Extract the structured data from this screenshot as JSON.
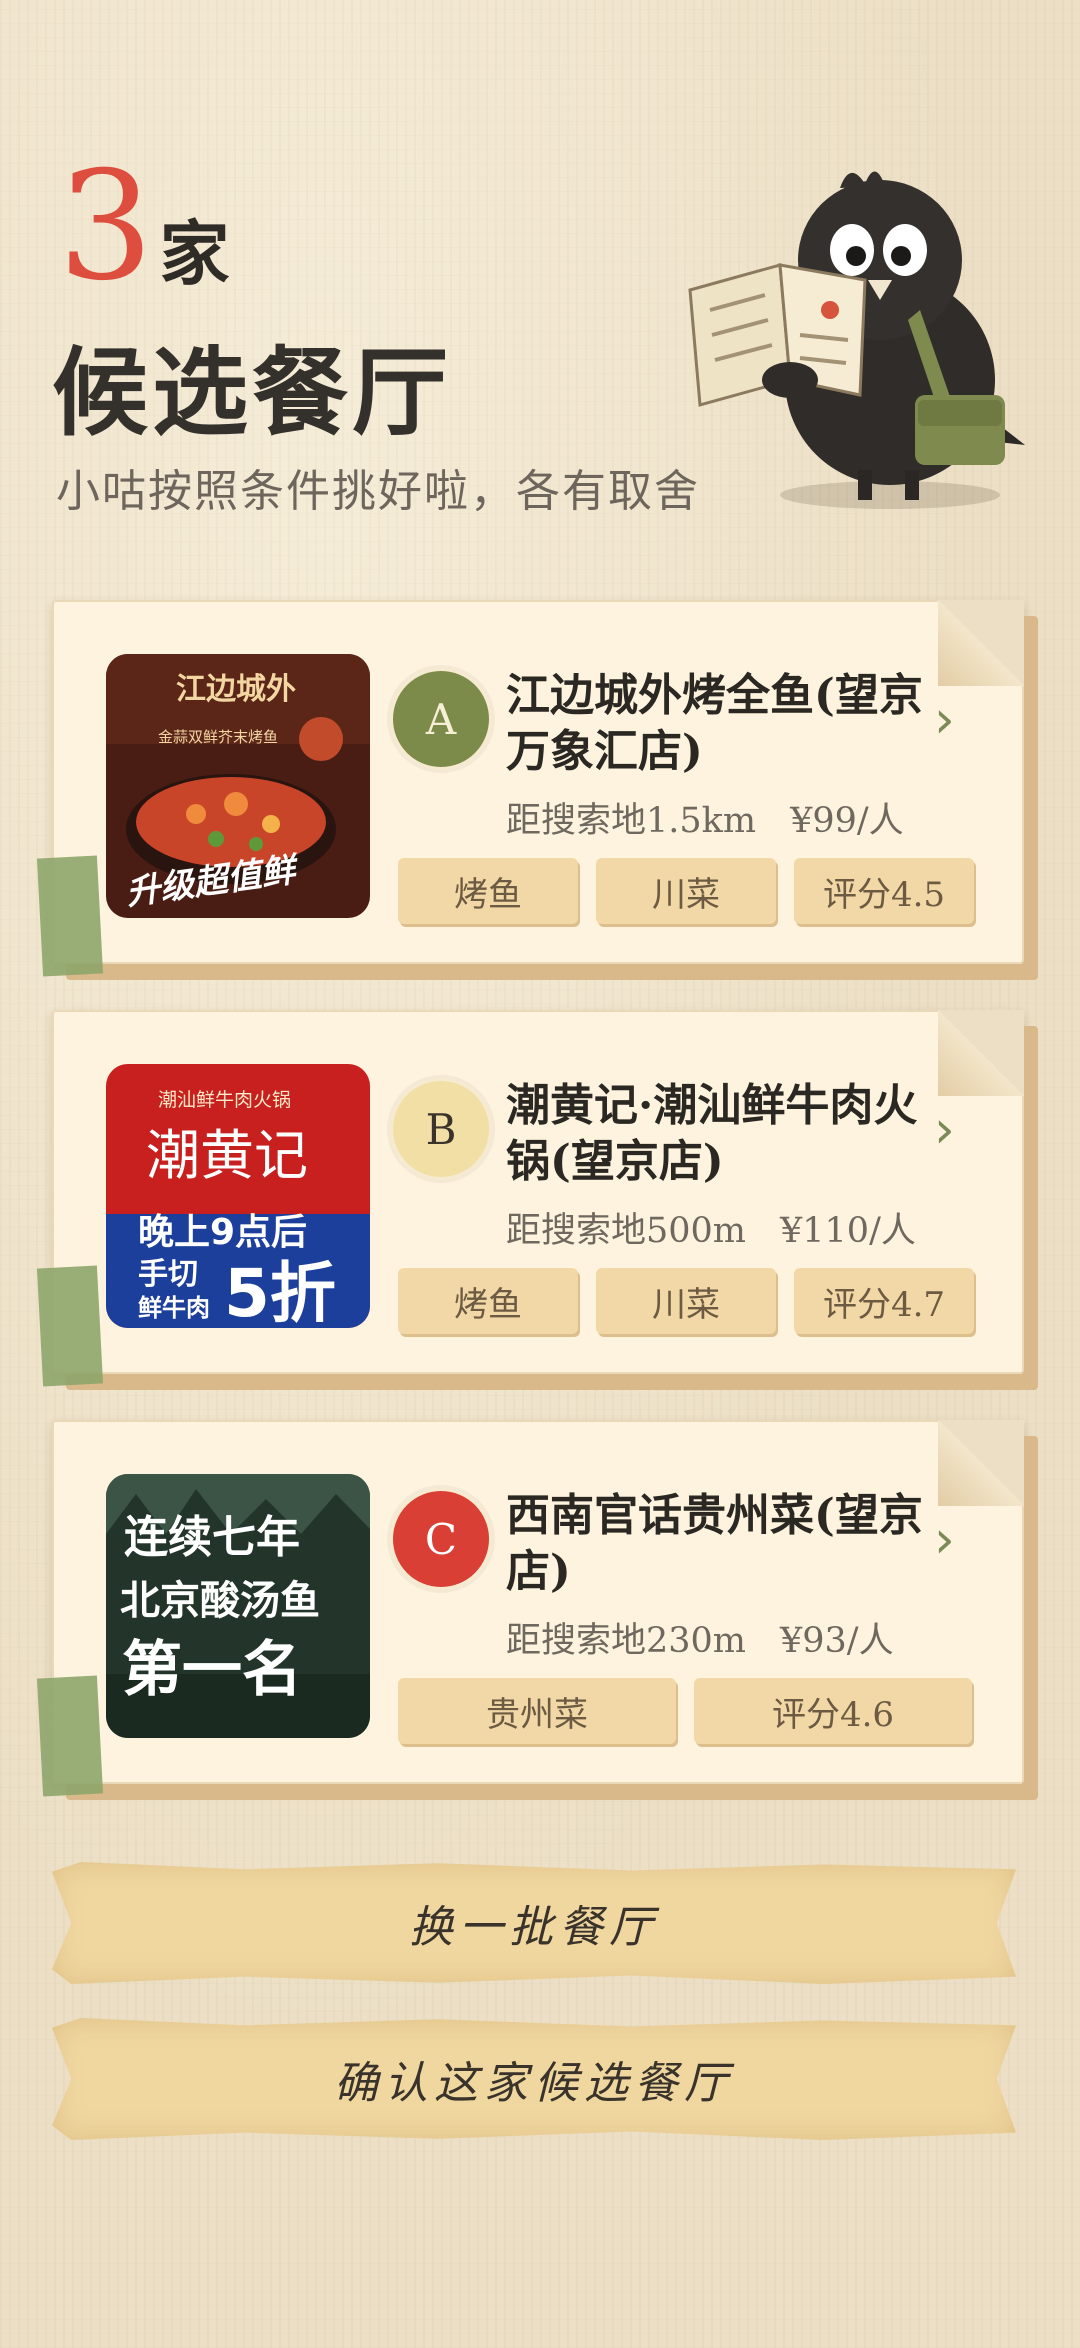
{
  "header": {
    "count_num": "3",
    "count_unit": "家",
    "title": "候选餐厅",
    "subtitle": "小咕按照条件挑好啦，各有取舍"
  },
  "restaurants": [
    {
      "badge": "A",
      "badge_color": "#7c8a4a",
      "badge_text_color": "#f7eed6",
      "name": "江边城外烤全鱼(望京万象汇店)",
      "distance": "距搜索地1.5km",
      "price": "¥99/人",
      "image_text": [
        "江边城外",
        "金蒜双鲜芥末烤鱼",
        "升级超值鲜"
      ],
      "tags": [
        "烤鱼",
        "川菜",
        "评分4.5"
      ]
    },
    {
      "badge": "B",
      "badge_color": "#f2dfa6",
      "badge_text_color": "#3a332b",
      "name": "潮黄记·潮汕鲜牛肉火锅(望京店)",
      "distance": "距搜索地500m",
      "price": "¥110/人",
      "image_text": [
        "潮汕鲜牛肉火锅",
        "潮黄记",
        "晚上9点后",
        "手切",
        "鲜牛肉",
        "5折"
      ],
      "tags": [
        "烤鱼",
        "川菜",
        "评分4.7"
      ]
    },
    {
      "badge": "C",
      "badge_color": "#d93f34",
      "badge_text_color": "#ffffff",
      "name": "西南官话贵州菜(望京店)",
      "distance": "距搜索地230m",
      "price": "¥93/人",
      "image_text": [
        "连续七年",
        "北京酸汤鱼",
        "第一名"
      ],
      "tags": [
        "贵州菜",
        "评分4.6"
      ]
    }
  ],
  "buttons": {
    "refresh": "换一批餐厅",
    "confirm": "确认这家候选餐厅"
  }
}
